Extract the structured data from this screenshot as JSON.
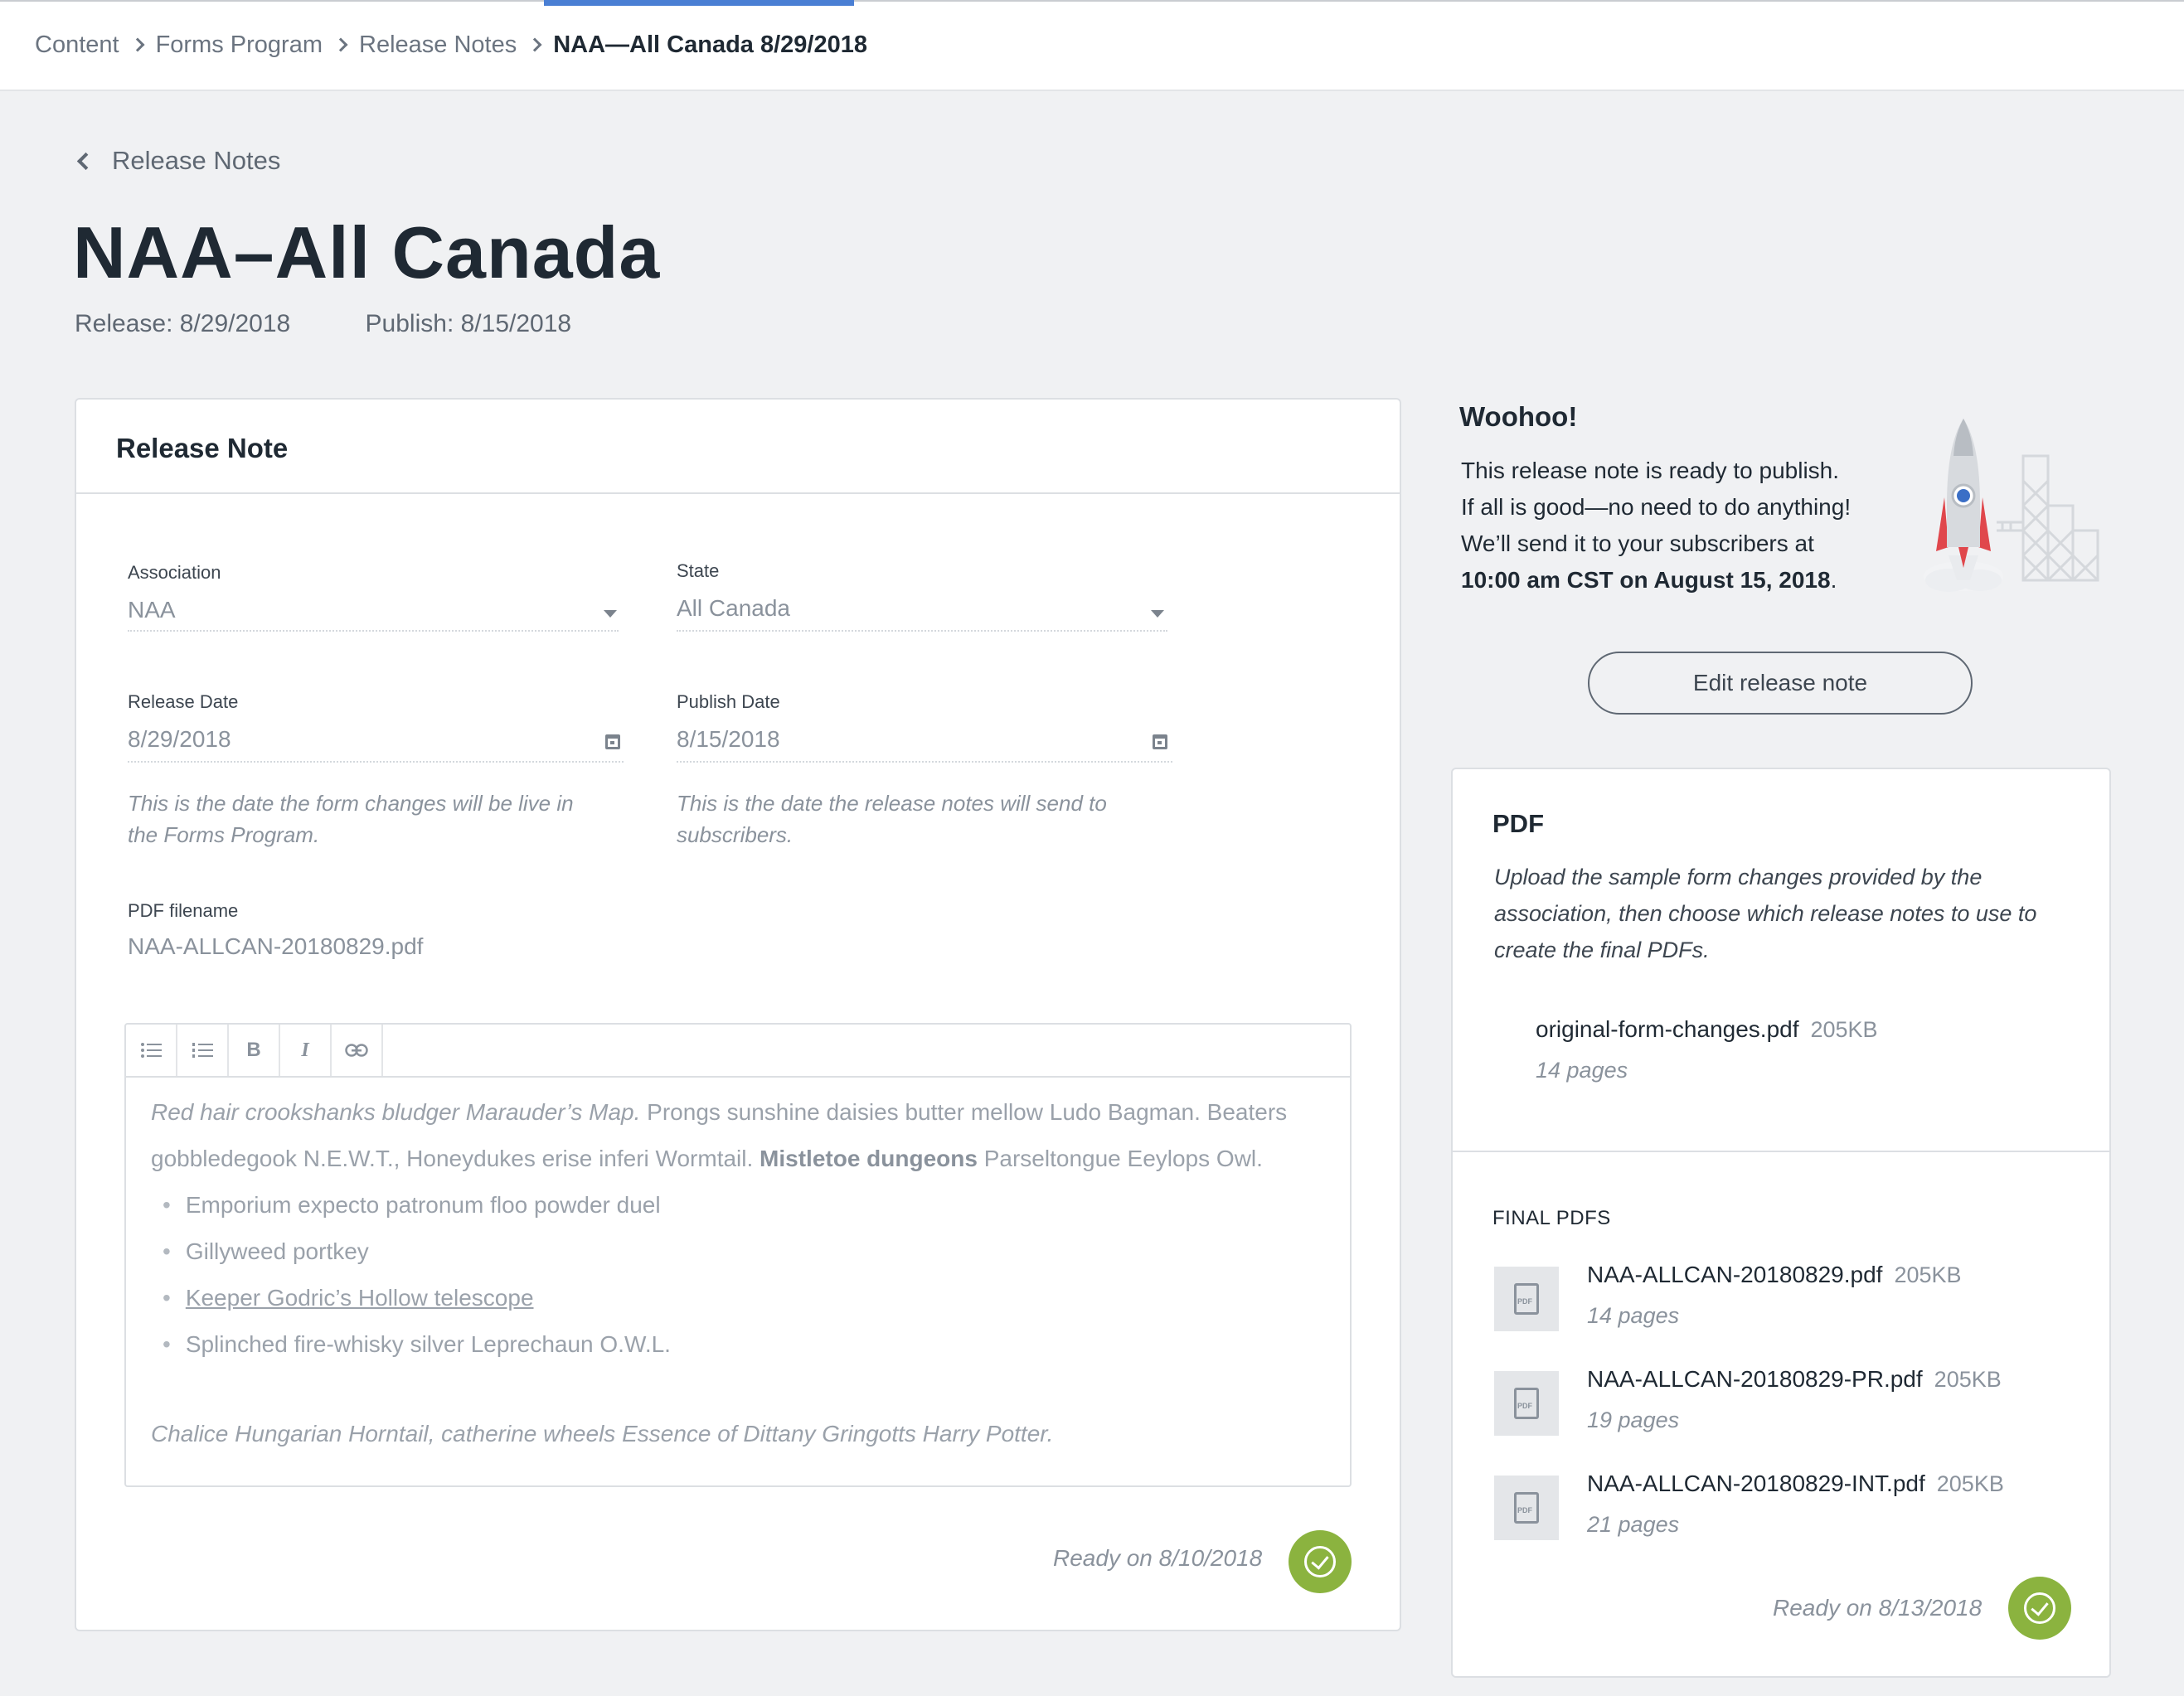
{
  "breadcrumb": {
    "items": [
      "Content",
      "Forms Program",
      "Release Notes"
    ],
    "current": "NAA—All Canada 8/29/2018"
  },
  "back_link": "Release Notes",
  "page_title": "NAA–All Canada",
  "release_label": "Release:  8/29/2018",
  "publish_label": "Publish:  8/15/2018",
  "release_note": {
    "title": "Release Note",
    "association": {
      "label": "Association",
      "value": "NAA"
    },
    "state": {
      "label": "State",
      "value": "All Canada"
    },
    "release_date": {
      "label": "Release Date",
      "value": "8/29/2018",
      "hint": "This is the date the form changes will be live in the Forms Program."
    },
    "publish_date": {
      "label": "Publish Date",
      "value": "8/15/2018",
      "hint": "This is the date the release notes will send to subscribers."
    },
    "pdf_filename": {
      "label": "PDF filename",
      "value": "NAA-ALLCAN-20180829.pdf"
    },
    "editor": {
      "toolbar": [
        "bullet-list",
        "numbered-list",
        "B",
        "I",
        "link"
      ],
      "para_italic": "Red hair crookshanks bludger Marauder’s Map.",
      "para_rest": " Prongs sunshine daisies butter mellow Ludo Bagman. Beaters gobbledegook N.E.W.T., Honeydukes erise inferi Wormtail. ",
      "para_bold": "Mistletoe dungeons",
      "para_end": " Parseltongue Eeylops Owl.",
      "bullets": [
        "Emporium expecto patronum floo powder duel",
        "Gillyweed portkey",
        "Keeper Godric’s Hollow telescope",
        "Splinched fire-whisky silver Leprechaun O.W.L."
      ],
      "closing": "Chalice Hungarian Horntail, catherine wheels Essence of Dittany Gringotts Harry Potter."
    },
    "ready": "Ready on 8/10/2018"
  },
  "woohoo": {
    "title": "Woohoo!",
    "line1": "This release note is ready to publish.",
    "line2": "If all is good—no need to do anything!",
    "line3": "We’ll send it to your subscribers at",
    "line4_bold": "10:00 am CST on August 15, 2018",
    "line4_end": ".",
    "edit_button": "Edit release note"
  },
  "pdf": {
    "title": "PDF",
    "description": "Upload the sample form changes provided by the association, then choose which release notes to use to create the final PDFs.",
    "original": {
      "name": "original-form-changes.pdf",
      "size": "205KB",
      "pages": "14 pages"
    },
    "final_label": "FINAL PDFS",
    "finals": [
      {
        "name": "NAA-ALLCAN-20180829.pdf",
        "size": "205KB",
        "pages": "14 pages"
      },
      {
        "name": "NAA-ALLCAN-20180829-PR.pdf",
        "size": "205KB",
        "pages": "19 pages"
      },
      {
        "name": "NAA-ALLCAN-20180829-INT.pdf",
        "size": "205KB",
        "pages": "21 pages"
      }
    ],
    "ready": "Ready on 8/13/2018"
  },
  "colors": {
    "accent": "#4a7fd4",
    "success": "#8bb33f",
    "rocket_red": "#e0474c"
  }
}
